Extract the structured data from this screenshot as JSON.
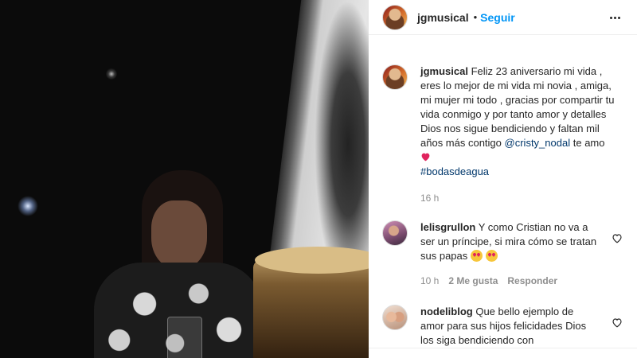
{
  "post": {
    "username": "jgmusical",
    "separator": "•",
    "follow_label": "Seguir",
    "more_label": "More options"
  },
  "caption": {
    "username": "jgmusical",
    "text_before_mention": "Feliz 23 aniversario mi vida , eres lo mejor de mi vida mi novia , amiga, mi mujer mi todo , gracias por compartir tu vida conmigo y por tanto amor y detalles Dios nos sigue bendiciendo y faltan mil años más contigo",
    "mention": "@cristy_nodal",
    "text_after_mention": "te amo",
    "hashtag": "#bodasdeagua",
    "time": "16 h"
  },
  "comments": [
    {
      "username": "lelisgrullon",
      "text": "Y como Cristian no va a ser un príncipe, si mira cómo se tratan sus papas",
      "time": "10 h",
      "likes": "2 Me gusta",
      "reply_label": "Responder"
    },
    {
      "username": "nodeliblog",
      "text": "Que bello ejemplo de amor para sus hijos felicidades Dios los siga bendiciendo con"
    }
  ],
  "icons": {
    "avatar": "avatar",
    "more": "more-horizontal-icon",
    "like": "heart-outline-icon",
    "heart_emoji": "red-heart-emoji",
    "love_emoji": "heart-eyes-emoji"
  },
  "colors": {
    "link_blue": "#0095f6",
    "mention": "#00376b",
    "meta_gray": "#8e8e8e",
    "text": "#262626"
  }
}
